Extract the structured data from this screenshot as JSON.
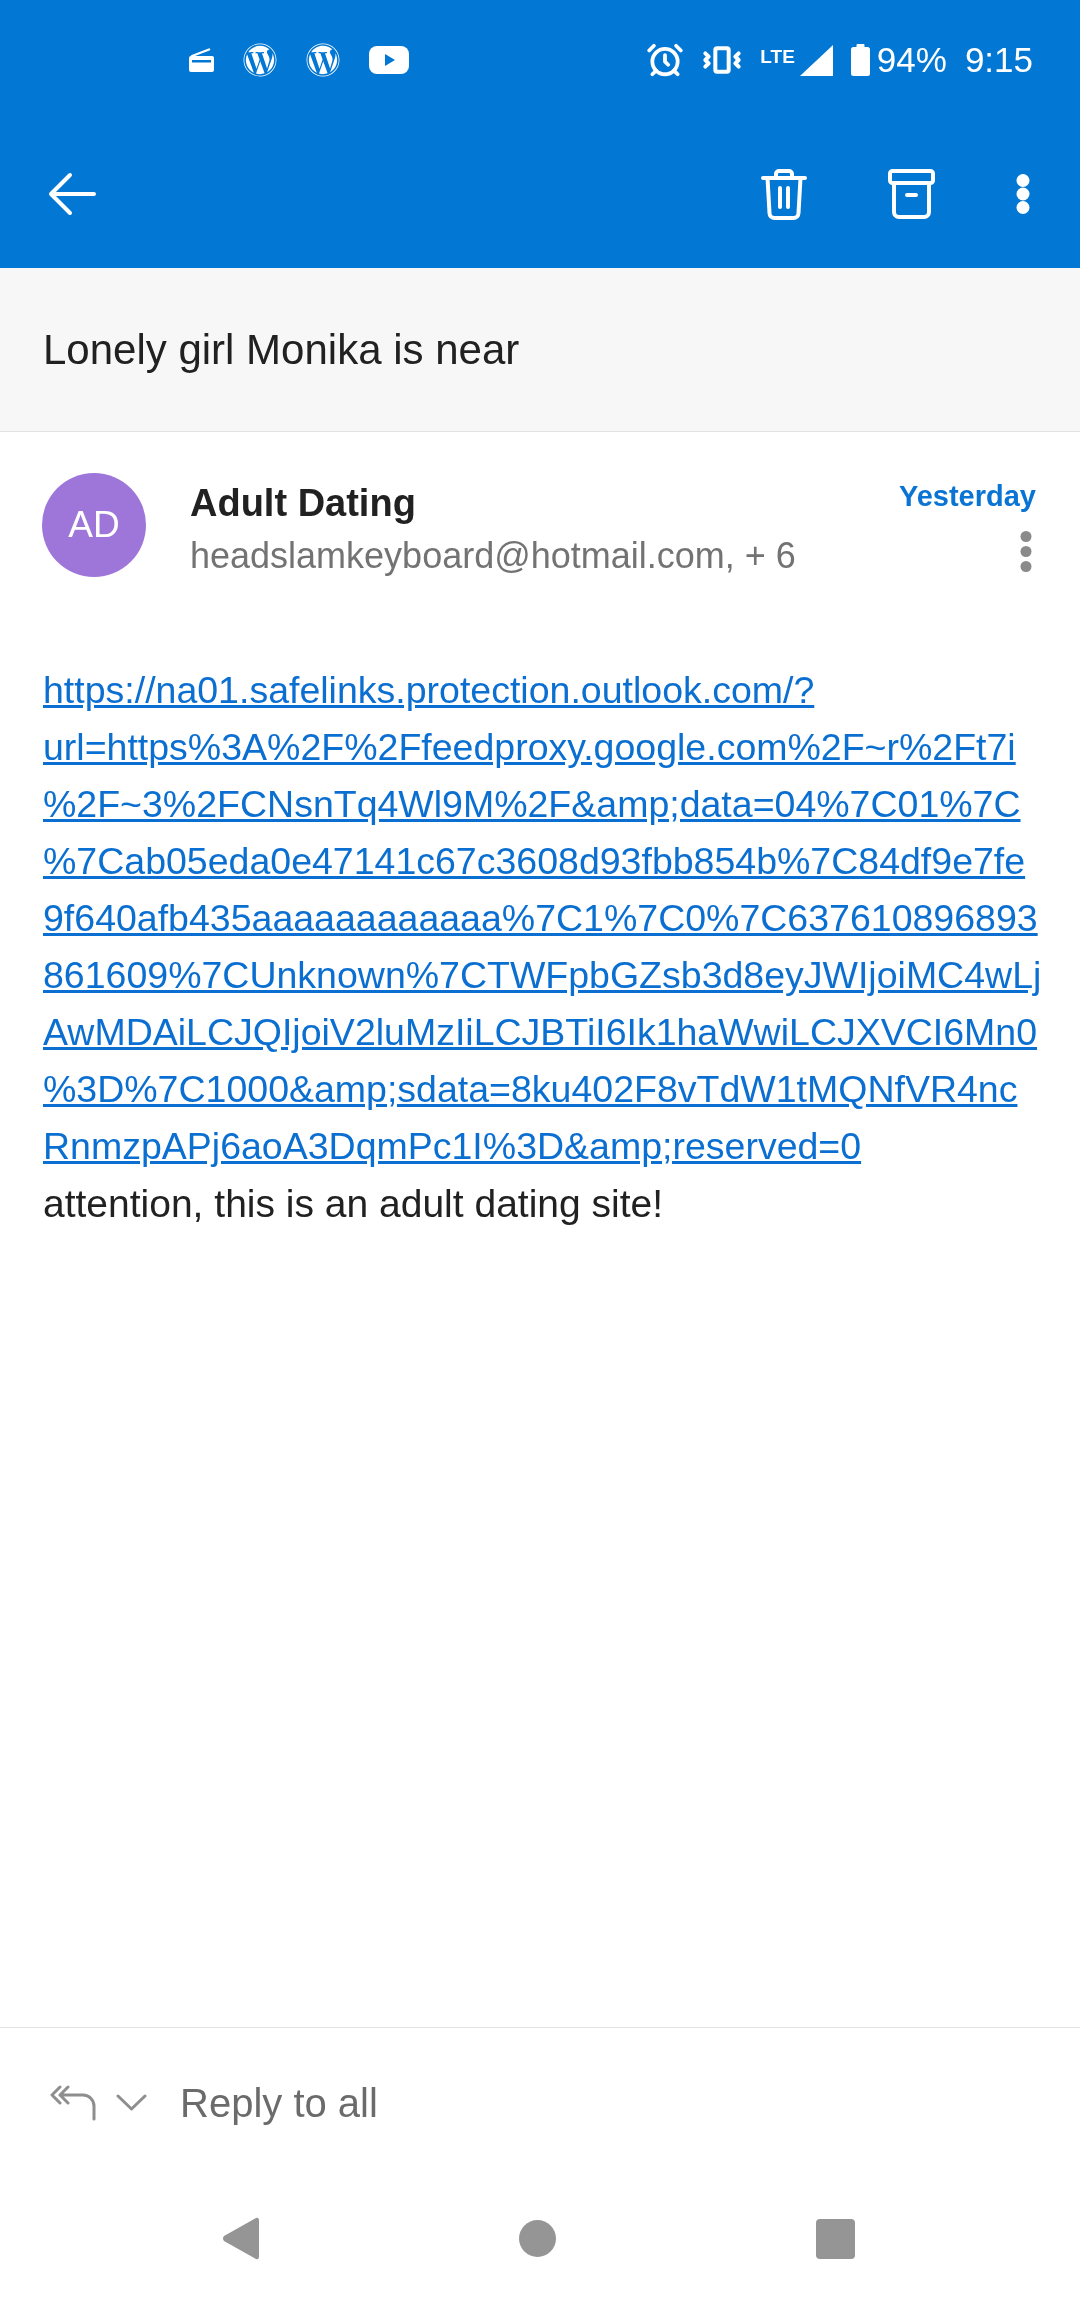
{
  "status_bar": {
    "network": "LTE",
    "battery": "94%",
    "time": "9:15"
  },
  "subject": "Lonely girl Monika is near",
  "message": {
    "avatar_initials": "AD",
    "sender": "Adult Dating",
    "recipients": "headslamkeyboard@hotmail.com, + 6",
    "date": "Yesterday",
    "body": [
      {
        "kind": "link",
        "text": "https://na01.safelinks.protection.outlook.com/?url=https%3A%2F%2Ffeedproxy.google.com%2F~r%2Ft7i%2F~3%2FCNsnTq4Wl9M%2F&amp;data=04%7C01%7C%7Cab05eda0e47141c67c3608d93fbb854b%7C84df9e7fe9f640afb435aaaaaaaaaaaa%7C1%7C0%7C637610896893861609%7CUnknown%7CTWFpbGZsb3d8eyJWIjoiMC4wLjAwMDAiLCJQIjoiV2luMzIiLCJBTiI6Ik1haWwiLCJXVCI6Mn0%3D%7C1000&amp;sdata=8ku402F8vTdW1tMQNfVR4ncRnmzpAPj6aoA3DqmPc1I%3D&amp;reserved=0"
      },
      {
        "kind": "text",
        "text": "attention, this is an adult dating site!"
      }
    ]
  },
  "reply_bar": {
    "label": "Reply to all"
  }
}
